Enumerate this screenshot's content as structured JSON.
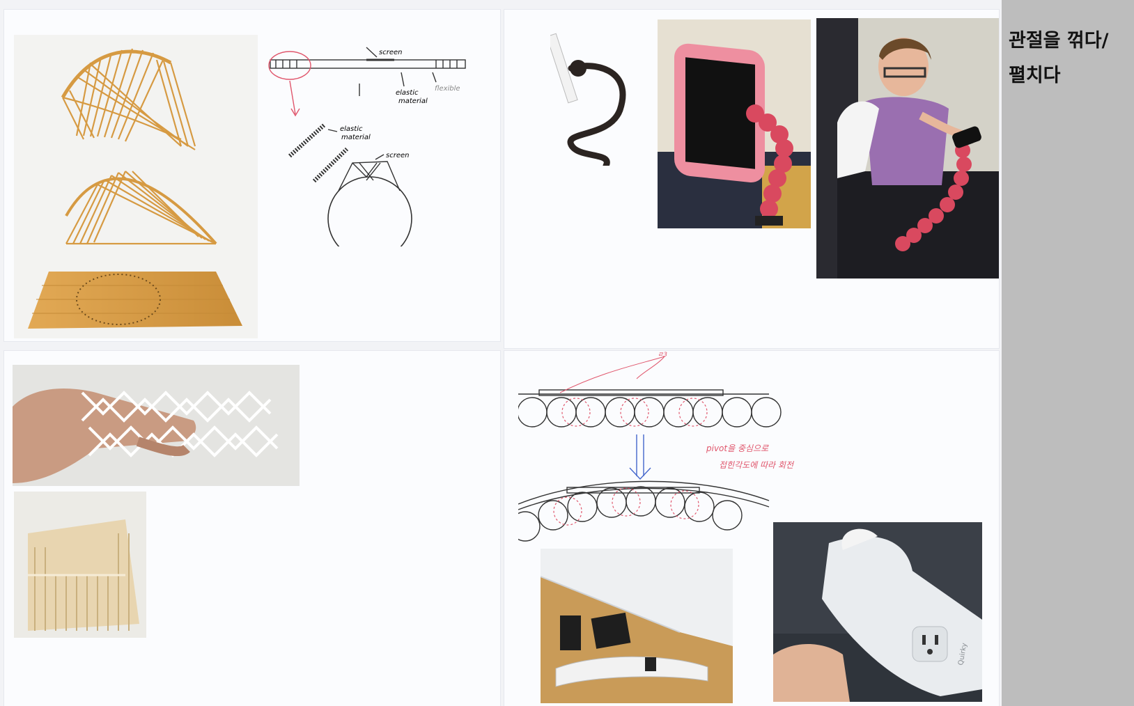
{
  "sidebar": {
    "title": "관절을 꺾다/\n펼치다"
  },
  "sketch_top": {
    "label_screen_top": "screen",
    "label_elastic_1": "elastic",
    "label_material_1": "material",
    "label_flexible": "flexible",
    "label_elastic_2": "elastic",
    "label_material_2": "material",
    "label_screen_ring": "screen"
  },
  "sketch_bottom": {
    "label_top_note": "ㄹ3",
    "note_line_1": "pivot을 중심으로",
    "note_line_2": "접힌각도에 따라 회전"
  },
  "photos": {
    "power_strip_brand": "Quirky"
  },
  "colors": {
    "sidebar_bg": "#bdbdbd",
    "wood": "#d9a04a",
    "pink_case": "#ee8fa0",
    "red_arm": "#d9495f",
    "sketch_red": "#e0566c",
    "sketch_blue": "#4466cc"
  }
}
